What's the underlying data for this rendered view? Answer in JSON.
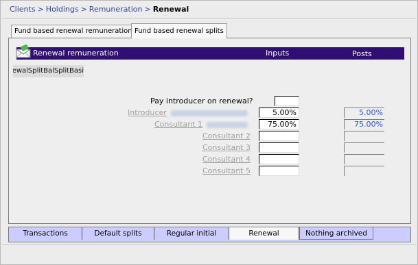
{
  "breadcrumb": {
    "items": [
      "Clients",
      "Holdings",
      "Remuneration"
    ],
    "separator": ">",
    "current": "Renewal"
  },
  "top_tabs": [
    {
      "label": "Fund based renewal remuneration",
      "active": false
    },
    {
      "label": "Fund based renewal splits",
      "active": true
    }
  ],
  "section": {
    "title": "Renewal remuneration",
    "col_inputs": "Inputs",
    "col_posts": "Posts",
    "header_color": "#2f0f75"
  },
  "overflow_label": "RenewalSplitBasisRenewalSplitBalSplitBasi",
  "form": {
    "question": "Pay introducer on renewal?",
    "question_value": "",
    "rows": [
      {
        "label": "Introducer",
        "input": "5.00%",
        "post": "5.00%"
      },
      {
        "label": "Consultant 1",
        "input": "75.00%",
        "post": "75.00%"
      },
      {
        "label": "Consultant 2",
        "input": "",
        "post": ""
      },
      {
        "label": "Consultant 3",
        "input": "",
        "post": ""
      },
      {
        "label": "Consultant 4",
        "input": "",
        "post": ""
      },
      {
        "label": "Consultant 5",
        "input": "",
        "post": ""
      }
    ]
  },
  "bottom_tabs": [
    {
      "label": "Transactions",
      "active": false
    },
    {
      "label": "Default splits",
      "active": false
    },
    {
      "label": "Regular initial",
      "active": false
    },
    {
      "label": "Renewal",
      "active": true
    },
    {
      "label": "Nothing archived",
      "active": false
    }
  ],
  "colors": {
    "link": "#3344aa",
    "post_value": "#3355dd",
    "tab_bar": "#ccccff"
  },
  "icons": {
    "section": "envelope-icon"
  }
}
